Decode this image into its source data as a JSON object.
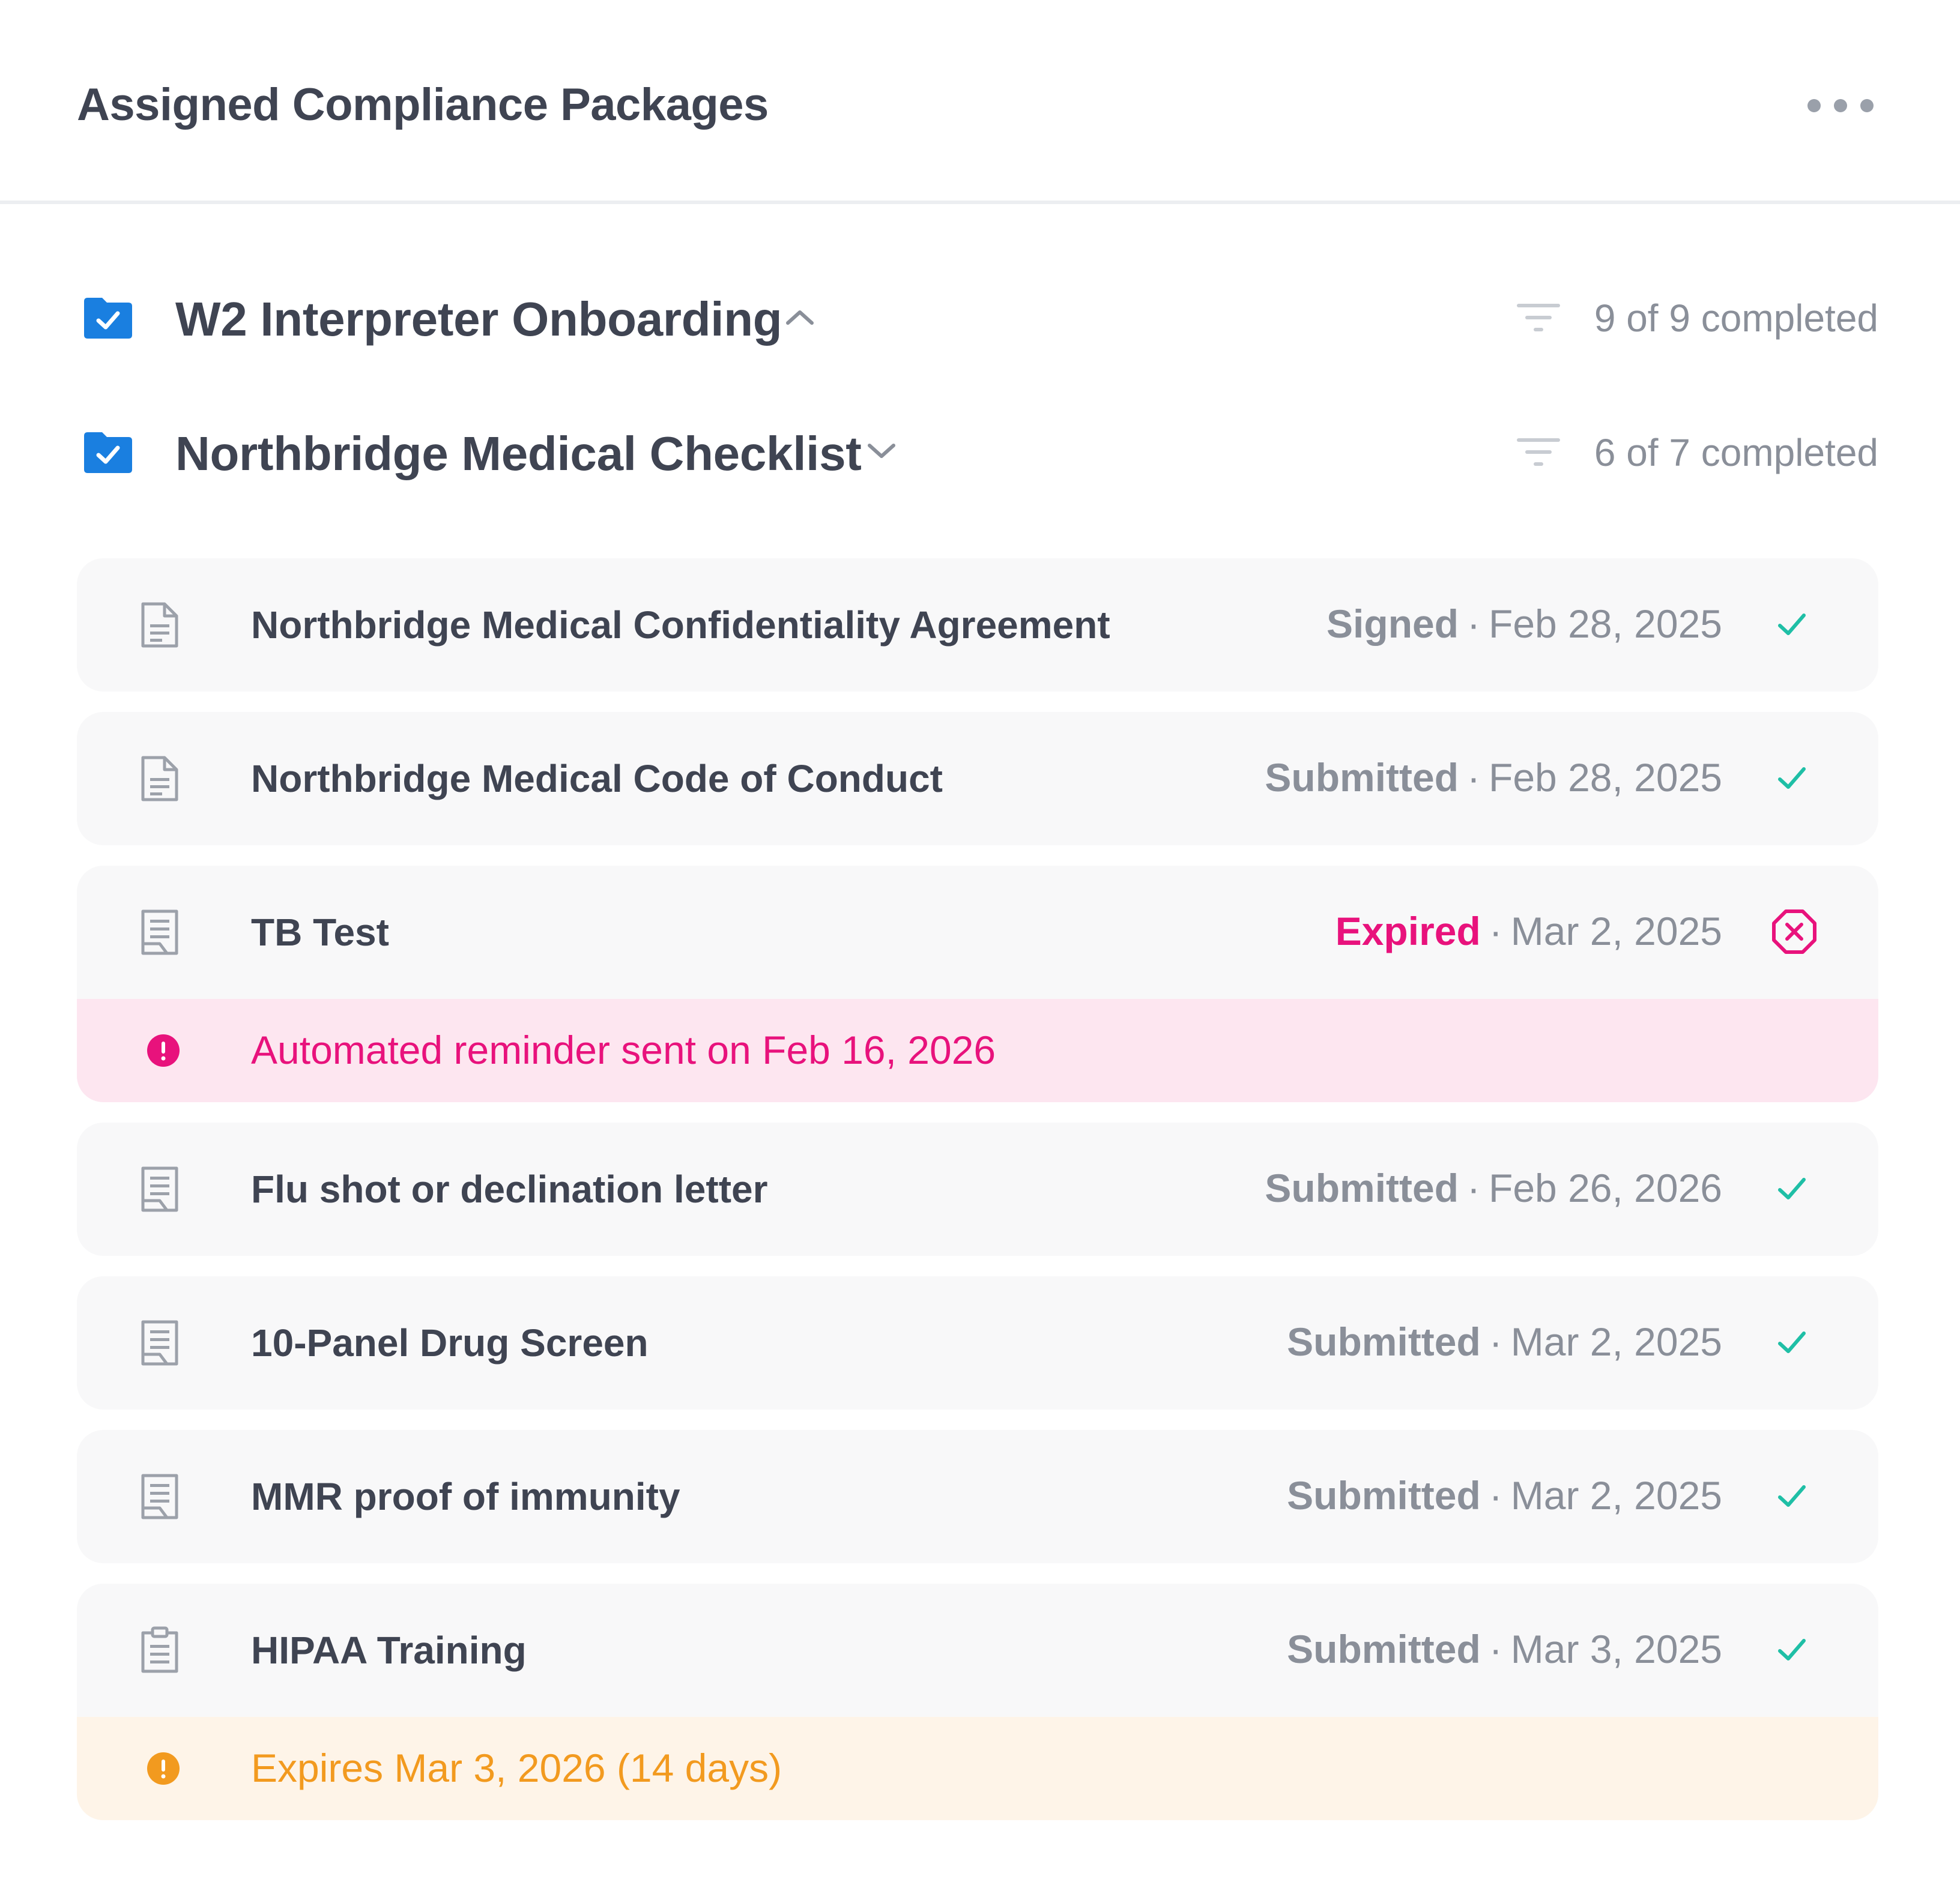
{
  "header": {
    "title": "Assigned Compliance Packages",
    "more_icon": "more-horizontal-icon"
  },
  "packages": [
    {
      "title": "W2 Interpreter Onboarding",
      "expanded": false,
      "chevron": "chevron-up",
      "count": "9 of 9 completed"
    },
    {
      "title": "Northbridge Medical Checklist",
      "expanded": true,
      "chevron": "chevron-down",
      "count": "6 of 7 completed"
    }
  ],
  "items": [
    {
      "title": "Northbridge Medical Confidentiality Agreement",
      "status": "Signed",
      "date": "Feb 28, 2025",
      "icon": "document-icon",
      "state": "complete"
    },
    {
      "title": "Northbridge Medical Code of Conduct",
      "status": "Submitted",
      "date": "Feb 28, 2025",
      "icon": "document-icon",
      "state": "complete"
    },
    {
      "title": "TB Test",
      "status": "Expired",
      "date": "Mar 2, 2025",
      "icon": "record-icon",
      "state": "expired",
      "alert": {
        "text": "Automated reminder sent on Feb 16, 2026",
        "tone": "pink"
      }
    },
    {
      "title": "Flu shot or declination letter",
      "status": "Submitted",
      "date": "Feb 26, 2026",
      "icon": "record-icon",
      "state": "complete"
    },
    {
      "title": "10-Panel Drug Screen",
      "status": "Submitted",
      "date": "Mar 2, 2025",
      "icon": "record-icon",
      "state": "complete"
    },
    {
      "title": "MMR proof of immunity",
      "status": "Submitted",
      "date": "Mar 2, 2025",
      "icon": "record-icon",
      "state": "complete"
    },
    {
      "title": "HIPAA Training",
      "status": "Submitted",
      "date": "Mar 3, 2025",
      "icon": "clipboard-icon",
      "state": "complete",
      "alert": {
        "text": "Expires Mar 3, 2026 (14 days)",
        "tone": "orange"
      }
    }
  ],
  "separator": "·",
  "colors": {
    "primary_blue": "#1a7fe0",
    "success_teal": "#1fbfa6",
    "expired_pink": "#e8127c",
    "warning_orange": "#f29a1f",
    "text_dark": "#3f4452",
    "text_muted": "#8a8f99",
    "card_bg": "#f8f8f9"
  }
}
